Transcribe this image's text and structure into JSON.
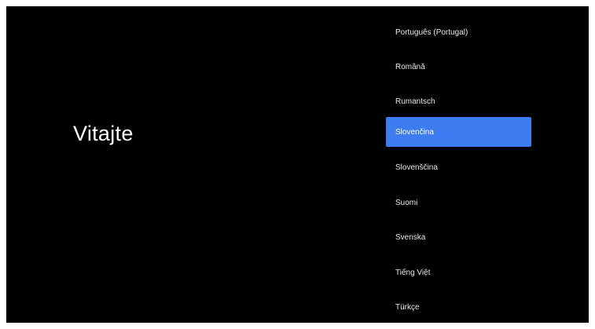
{
  "welcome_title": "Vitajte",
  "languages": [
    {
      "label": "Português (Portugal)",
      "selected": false
    },
    {
      "label": "Română",
      "selected": false
    },
    {
      "label": "Rumantsch",
      "selected": false
    },
    {
      "label": "Slovenčina",
      "selected": true
    },
    {
      "label": "Slovenščina",
      "selected": false
    },
    {
      "label": "Suomi",
      "selected": false
    },
    {
      "label": "Svenska",
      "selected": false
    },
    {
      "label": "Tiếng Việt",
      "selected": false
    },
    {
      "label": "Türkçe",
      "selected": false
    }
  ],
  "colors": {
    "background": "#000000",
    "selection": "#3d7bf0",
    "text": "#ffffff"
  }
}
